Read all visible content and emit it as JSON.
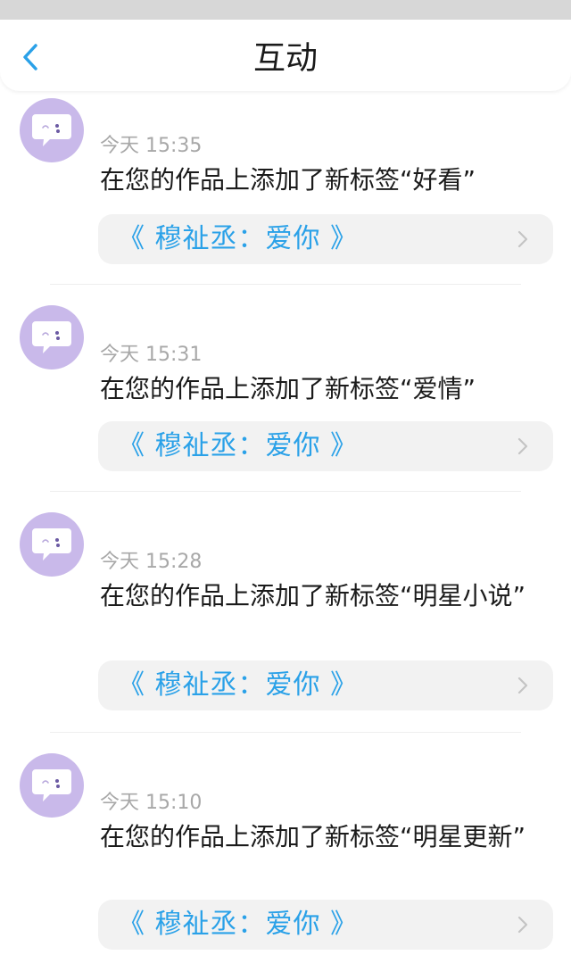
{
  "header": {
    "title": "互动"
  },
  "items": [
    {
      "time": "今天 15:35",
      "message": "在您的作品上添加了新标签“好看”",
      "work": "《 穆祉丞：爱你 》"
    },
    {
      "time": "今天 15:31",
      "message": "在您的作品上添加了新标签“爱情”",
      "work": "《 穆祉丞：爱你 》"
    },
    {
      "time": "今天 15:28",
      "message": "在您的作品上添加了新标签“明星小说”",
      "work": "《 穆祉丞：爱你 》"
    },
    {
      "time": "今天 15:10",
      "message": "在您的作品上添加了新标签“明星更新”",
      "work": "《 穆祉丞：爱你 》"
    }
  ],
  "colors": {
    "accent": "#2aa1e8",
    "avatar_bg": "#c9b9ea",
    "card_bg": "#f2f2f2"
  }
}
